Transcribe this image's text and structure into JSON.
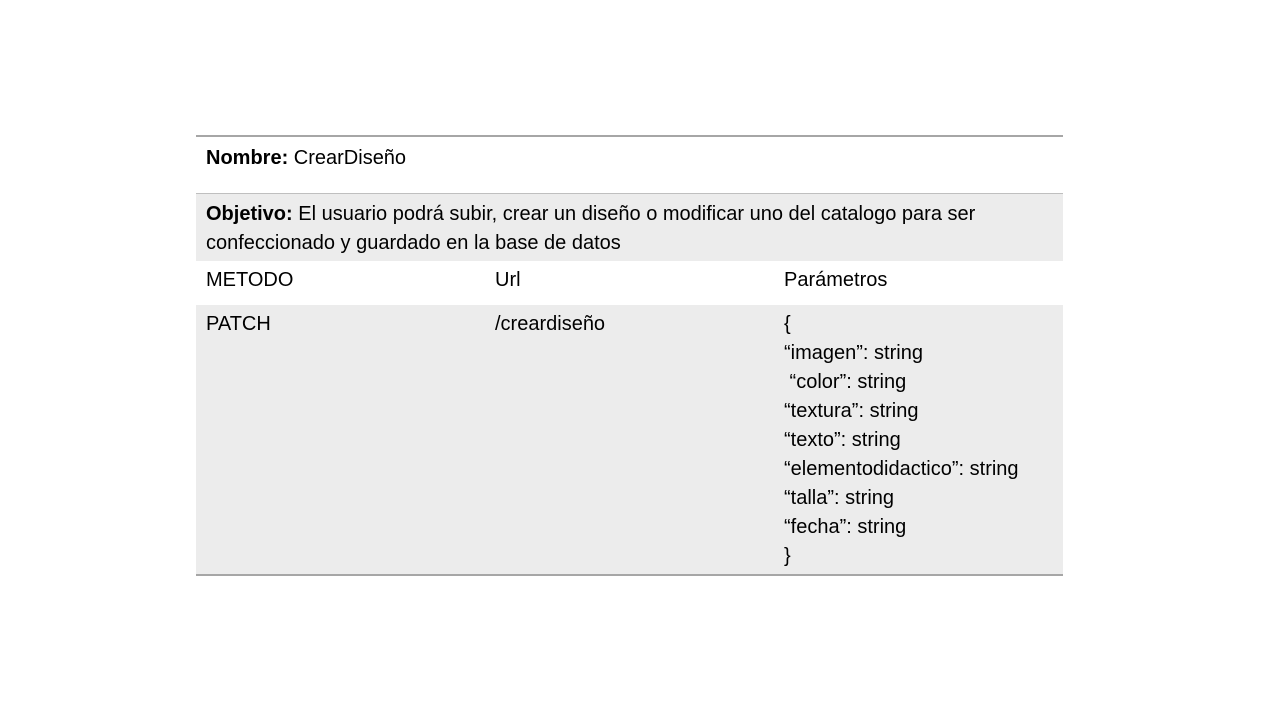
{
  "name": {
    "label": "Nombre:",
    "value": " CrearDiseño"
  },
  "objective": {
    "label": "Objetivo:",
    "value": " El usuario podrá subir, crear un diseño o modificar uno del catalogo para ser confeccionado y guardado en la base de datos"
  },
  "columns": {
    "method": "METODO",
    "url": "Url",
    "params": "Parámetros"
  },
  "row": {
    "method": "PATCH",
    "url": "/creardiseño",
    "params": [
      "{",
      "“imagen”: string",
      " “color”: string",
      "“textura”: string",
      "“texto”: string",
      "“elementodidactico”: string",
      "“talla”: string",
      "“fecha”: string",
      "}"
    ]
  }
}
